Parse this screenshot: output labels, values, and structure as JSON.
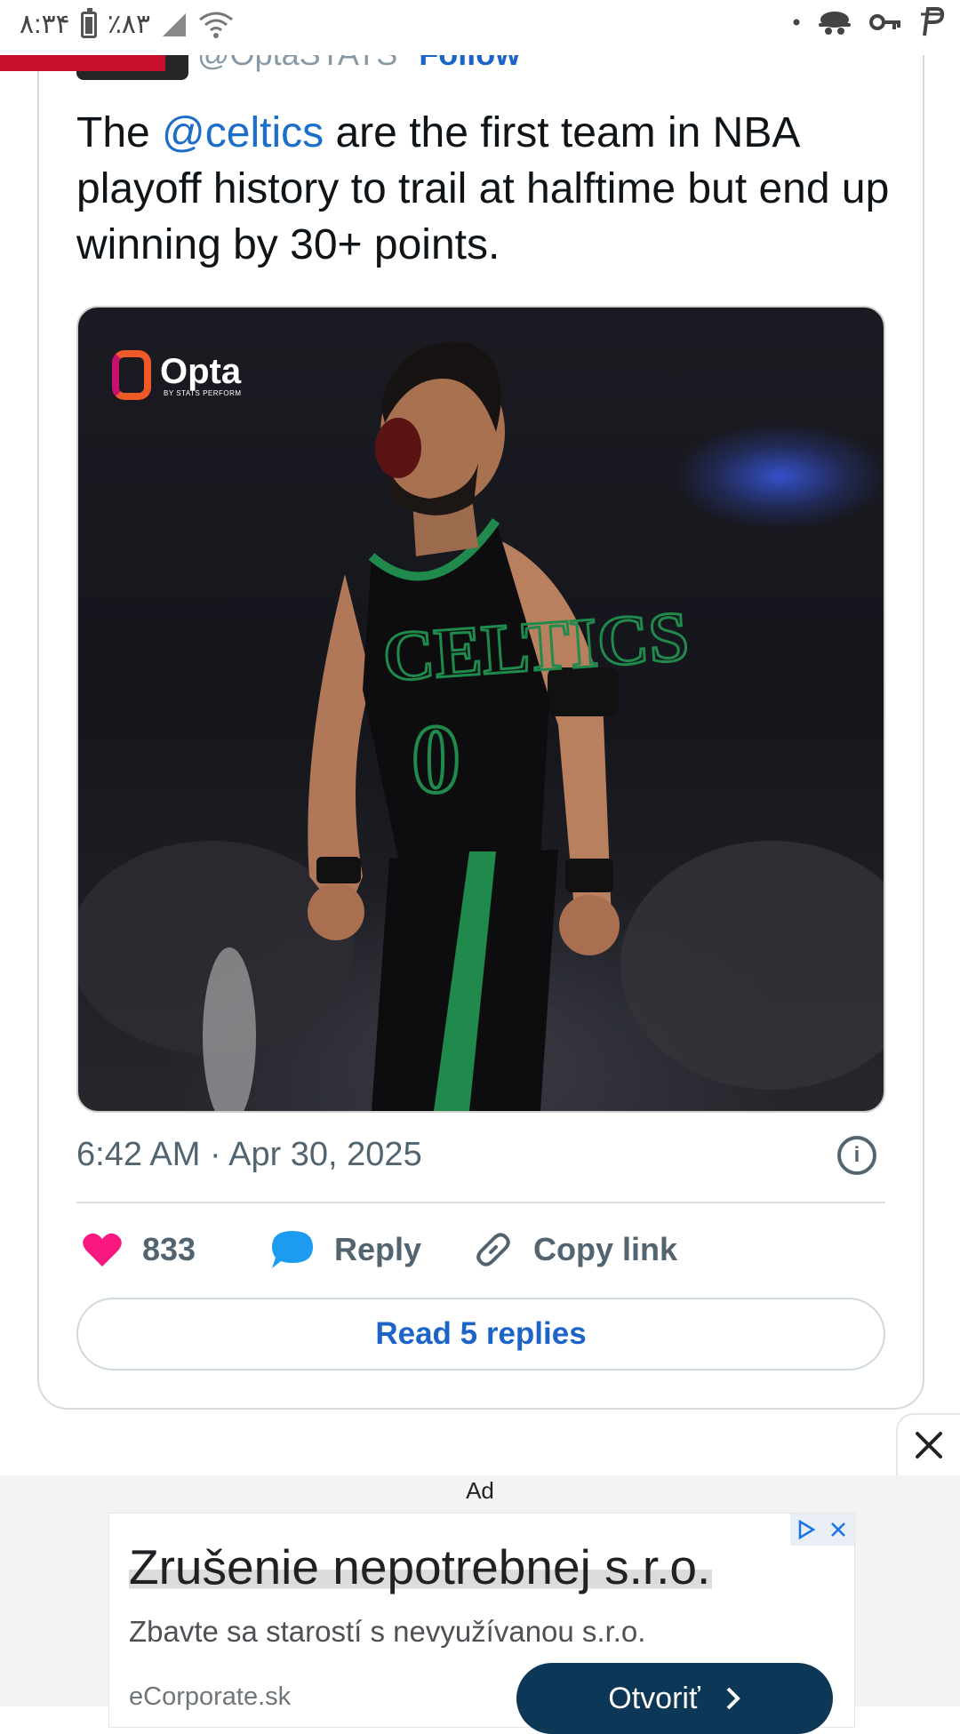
{
  "status_bar": {
    "time": "۸:۳۴",
    "battery": "٪۸۳"
  },
  "tweet": {
    "handle_partial": "@OptaSTATS",
    "follow_label": "Follow",
    "text_before": "The ",
    "mention": "@celtics",
    "text_after": " are the first team in NBA playoff history to trail at halftime but end up winning by 30+ points.",
    "media_brand": "Opta",
    "media_brand_sub": "BY STATS PERFORM",
    "timestamp": "6:42 AM · Apr 30, 2025",
    "like_count": "833",
    "reply_label": "Reply",
    "copy_link_label": "Copy link",
    "read_replies_label": "Read 5 replies"
  },
  "ad": {
    "label": "Ad",
    "headline": "Zrušenie nepotrebnej s.r.o.",
    "description": "Zbavte sa starostí s nevyužívanou s.r.o.",
    "domain": "eCorporate.sk",
    "cta_label": "Otvoriť"
  },
  "colors": {
    "link_blue": "#1d6ec8",
    "like_pink": "#f91880",
    "reply_blue": "#1d9bf0",
    "ad_button": "#0d3756",
    "brand_red": "#c8102e"
  },
  "icons": {
    "status_left": [
      "battery-icon",
      "signal-icon",
      "wifi-icon"
    ],
    "status_right": [
      "dot-icon",
      "incognito-icon",
      "key-icon",
      "p-icon"
    ],
    "actions": [
      "heart-icon",
      "speech-bubble-icon",
      "link-icon"
    ],
    "ad": [
      "adchoices-icon",
      "close-icon"
    ]
  }
}
